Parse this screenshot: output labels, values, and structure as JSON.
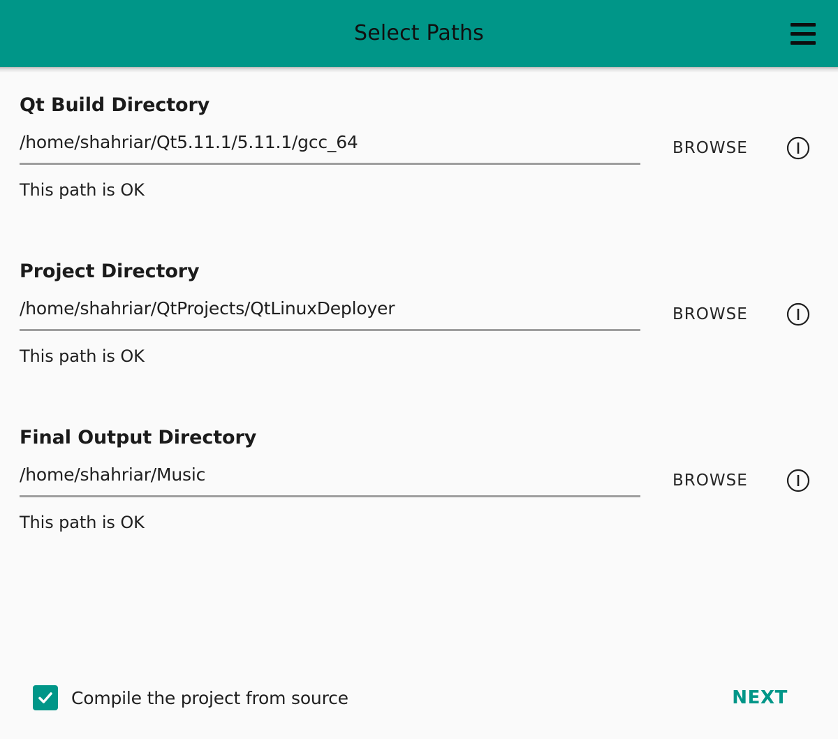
{
  "window": {
    "title": "Select Paths"
  },
  "toolbar": {
    "title": "Select Paths",
    "menu_icon": "hamburger-menu-icon"
  },
  "theme": {
    "accent": "#009688",
    "background": "#fafafa",
    "text": "#1f1f1f",
    "underline": "#9e9e9e"
  },
  "fields": [
    {
      "label": "Qt Build Directory",
      "value": "/home/shahriar/Qt5.11.1/5.11.1/gcc_64",
      "placeholder": "",
      "browse_label": "BROWSE",
      "info_icon": "info-circle-icon",
      "status": "This path is OK"
    },
    {
      "label": "Project Directory",
      "value": "/home/shahriar/QtProjects/QtLinuxDeployer",
      "placeholder": "",
      "browse_label": "BROWSE",
      "info_icon": "info-circle-icon",
      "status": "This path is OK"
    },
    {
      "label": "Final Output Directory",
      "value": "/home/shahriar/Music",
      "placeholder": "",
      "browse_label": "BROWSE",
      "info_icon": "info-circle-icon",
      "status": "This path is OK"
    }
  ],
  "footer": {
    "checkbox_label": "Compile the project from source",
    "checkbox_checked": true,
    "next_label": "NEXT"
  }
}
